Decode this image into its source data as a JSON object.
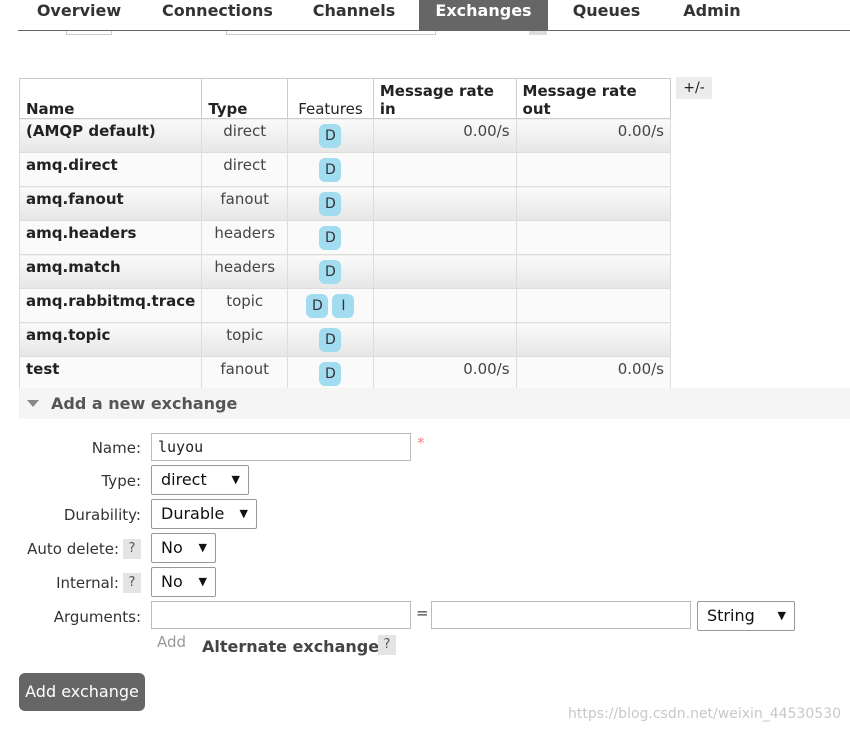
{
  "nav": {
    "tabs": [
      {
        "label": "Overview"
      },
      {
        "label": "Connections"
      },
      {
        "label": "Channels"
      },
      {
        "label": "Exchanges",
        "active": true
      },
      {
        "label": "Queues"
      },
      {
        "label": "Admin"
      }
    ]
  },
  "table": {
    "headers": [
      "Name",
      "Type",
      "Features",
      "Message rate in",
      "Message rate out"
    ],
    "toggle_label": "+/-",
    "rows": [
      {
        "name": "(AMQP default)",
        "type": "direct",
        "features": [
          "D"
        ],
        "rate_in": "0.00/s",
        "rate_out": "0.00/s"
      },
      {
        "name": "amq.direct",
        "type": "direct",
        "features": [
          "D"
        ],
        "rate_in": "",
        "rate_out": ""
      },
      {
        "name": "amq.fanout",
        "type": "fanout",
        "features": [
          "D"
        ],
        "rate_in": "",
        "rate_out": ""
      },
      {
        "name": "amq.headers",
        "type": "headers",
        "features": [
          "D"
        ],
        "rate_in": "",
        "rate_out": ""
      },
      {
        "name": "amq.match",
        "type": "headers",
        "features": [
          "D"
        ],
        "rate_in": "",
        "rate_out": ""
      },
      {
        "name": "amq.rabbitmq.trace",
        "type": "topic",
        "features": [
          "D",
          "I"
        ],
        "rate_in": "",
        "rate_out": ""
      },
      {
        "name": "amq.topic",
        "type": "topic",
        "features": [
          "D"
        ],
        "rate_in": "",
        "rate_out": ""
      },
      {
        "name": "test",
        "type": "fanout",
        "features": [
          "D"
        ],
        "rate_in": "0.00/s",
        "rate_out": "0.00/s"
      }
    ]
  },
  "form": {
    "section_title": "Add a new exchange",
    "name_label": "Name:",
    "name_value": "luyou",
    "required_mark": "*",
    "type_label": "Type:",
    "type_value": "direct",
    "durability_label": "Durability:",
    "durability_value": "Durable",
    "auto_delete_label": "Auto delete:",
    "auto_delete_value": "No",
    "internal_label": "Internal:",
    "internal_value": "No",
    "help_mark": "?",
    "arguments_label": "Arguments:",
    "arguments_key": "",
    "arguments_value": "",
    "equals": "=",
    "arguments_type_value": "String",
    "add_link": "Add",
    "alternate_exchange_label": "Alternate exchange",
    "submit_label": "Add exchange"
  },
  "watermark": "https://blog.csdn.net/weixin_44530530",
  "colors": {
    "nav_active": "#666666",
    "badge": "#a2dcf0",
    "button": "#666666"
  }
}
